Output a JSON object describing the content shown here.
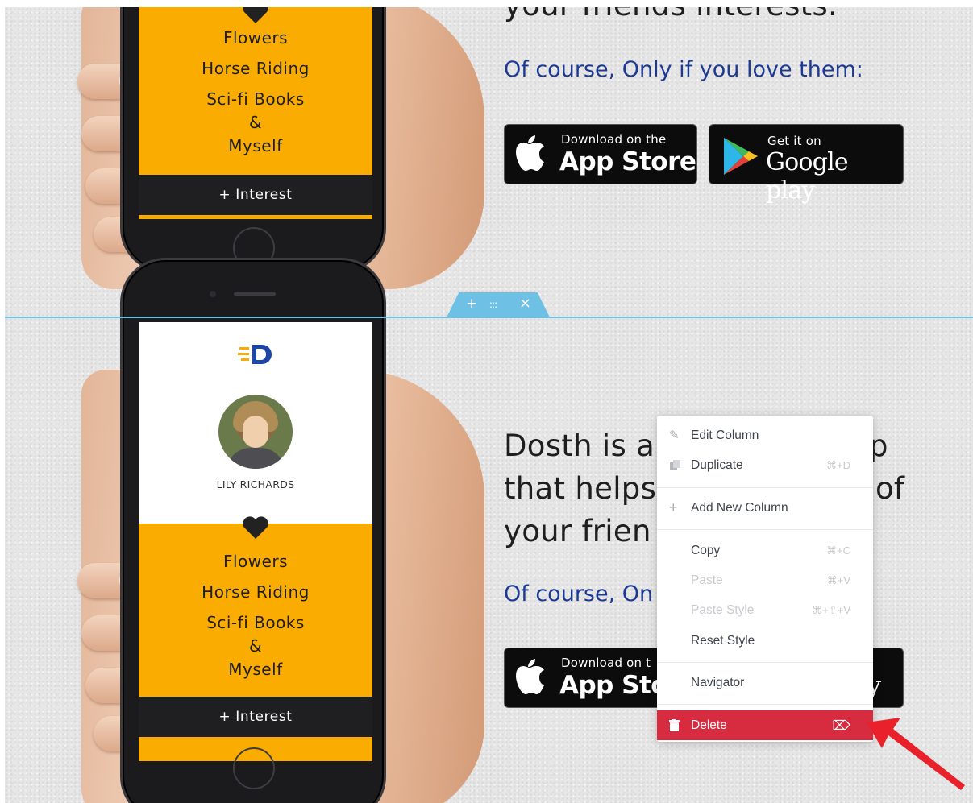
{
  "phones": [
    {
      "interests": [
        "Flowers",
        "Horse Riding",
        "Sci-fi Books",
        "&",
        "Myself"
      ],
      "interest_button": "+ Interest"
    },
    {
      "logo": "D",
      "user_name": "LILY RICHARDS",
      "interests": [
        "Flowers",
        "Horse Riding",
        "Sci-fi Books",
        "&",
        "Myself"
      ],
      "interest_button": "+ Interest"
    }
  ],
  "top_section": {
    "heading_partial": "your friends interests.",
    "subtitle": "Of course, Only if you love them:"
  },
  "bottom_section": {
    "heading_lines": [
      "Dosth is a",
      "p",
      "that helps",
      "of",
      "your frien"
    ],
    "subtitle": "Of course, On"
  },
  "badges": {
    "app_store_small": "Download on the",
    "app_store_big": "App Store",
    "google_small": "Get it on",
    "google_big": "Google play",
    "app_store_small_cut": "Download on t",
    "app_store_big_cut": "App Sto",
    "google_big_cut": "y"
  },
  "section_controls": {
    "add": "+",
    "drag": ":::",
    "close": "×"
  },
  "context_menu": {
    "items": [
      {
        "label": "Edit Column",
        "shortcut": "",
        "icon": "pencil-icon",
        "disabled": false
      },
      {
        "label": "Duplicate",
        "shortcut": "⌘+D",
        "icon": "duplicate-icon",
        "disabled": false
      },
      {
        "label": "Add New Column",
        "shortcut": "",
        "icon": "plus-icon",
        "disabled": false
      },
      {
        "label": "Copy",
        "shortcut": "⌘+C",
        "icon": "",
        "disabled": false
      },
      {
        "label": "Paste",
        "shortcut": "⌘+V",
        "icon": "",
        "disabled": true
      },
      {
        "label": "Paste Style",
        "shortcut": "⌘+⇧+V",
        "icon": "",
        "disabled": true
      },
      {
        "label": "Reset Style",
        "shortcut": "",
        "icon": "",
        "disabled": false
      },
      {
        "label": "Navigator",
        "shortcut": "",
        "icon": "",
        "disabled": false
      },
      {
        "label": "Delete",
        "shortcut": "⌦",
        "icon": "trash-icon",
        "disabled": false
      }
    ]
  },
  "colors": {
    "accent_yellow": "#fbac00",
    "section_blue": "#6ec1e4",
    "subtitle_blue": "#1c3a94",
    "delete_red": "#d72b3f",
    "arrow_red": "#e8212a"
  }
}
